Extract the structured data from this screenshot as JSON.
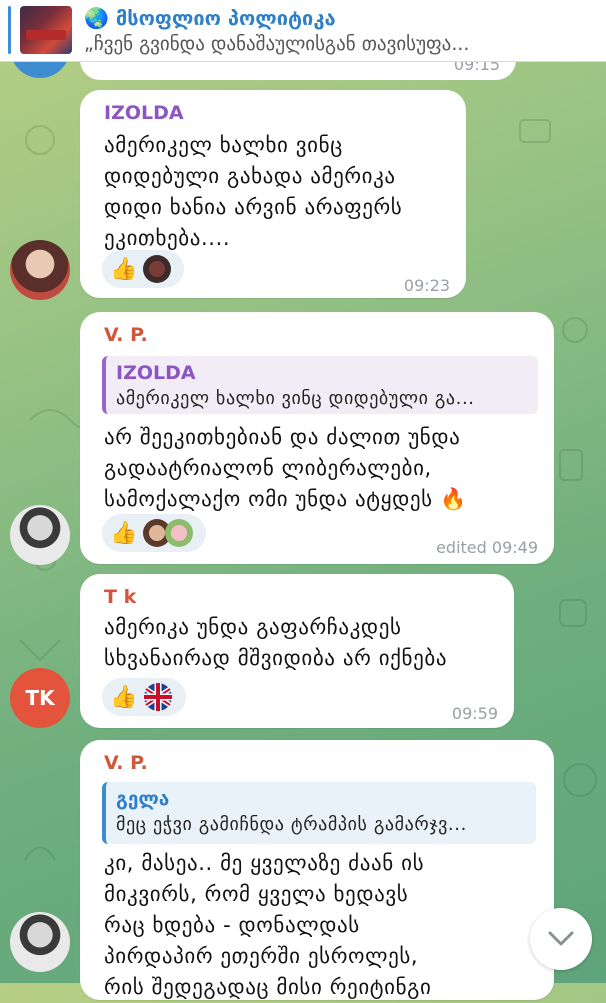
{
  "header": {
    "channel_title": "🌏 მსოფლიო პოლიტიკა",
    "pinned_text": "„ჩვენ გვინდა დანაშაულისგან თავისუფა..."
  },
  "messages": [
    {
      "time": "09:15"
    },
    {
      "author": "IZOLDA",
      "author_color": "#8d54c3",
      "lines": [
        "ამერიკელ ხალხი ვინც",
        "დიდებული გახადა ამერიკა",
        "დიდი ხანია არვინ არაფერს",
        "ეკითხება...."
      ],
      "time": "09:23",
      "reaction_icon": "thumbs-up"
    },
    {
      "author": "V. P.",
      "author_color": "#d2563a",
      "reply_author": "IZOLDA",
      "reply_text": "ამერიკელ ხალხი ვინც დიდებული გა...",
      "lines": [
        "არ შეეკითხებიან და ძალით უნდა",
        "გადაატრიალონ ლიბერალები,",
        "სამოქალაქო ომი უნდა ატყდეს 🔥"
      ],
      "time": "edited 09:49",
      "reaction_icon": "thumbs-up"
    },
    {
      "author": "T k",
      "author_color": "#d2563a",
      "avatar_initials": "TK",
      "lines": [
        "ამერიკა უნდა გაფარჩაკდეს",
        "სხვანაირად მშვიდიბა არ იქნება"
      ],
      "time": "09:59",
      "reaction_icon": "thumbs-up"
    },
    {
      "author": "V. P.",
      "author_color": "#d2563a",
      "reply_author": "გელა",
      "reply_text": "მეც ეჭვი გამიჩნდა ტრამპის გამარჯვ...",
      "lines": [
        "კი, მასეა.. მე ყველაზე ძაან ის",
        "მიკვირს, რომ ყველა ხედავს",
        "რაც ხდება - დონალდას",
        "პირდაპირ ეთერში ესროლეს,",
        "რის შედეგადაც მისი რეიტინგი"
      ]
    }
  ],
  "scroll_down_icon": "chevron-down-icon"
}
